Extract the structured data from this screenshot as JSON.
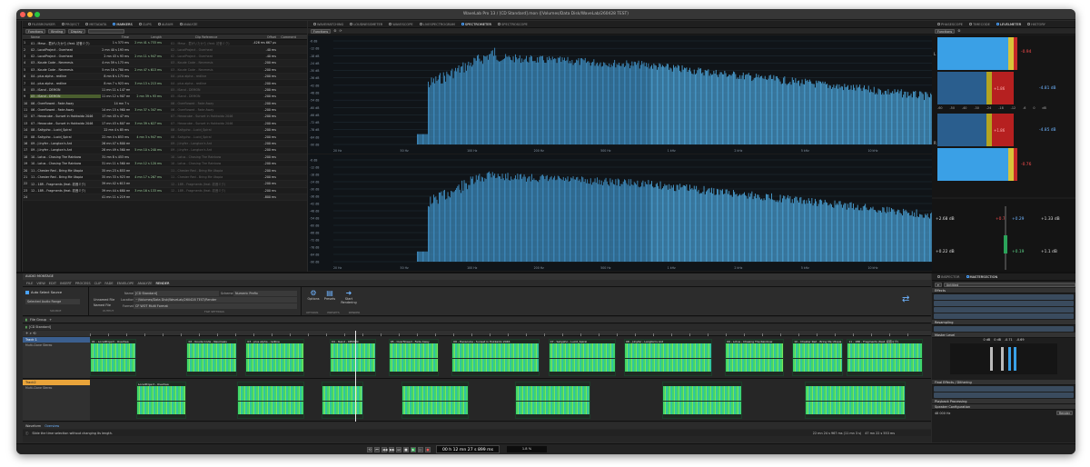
{
  "window": {
    "title": "WaveLab Pro 13 / [CD Standard].mon ([Volumes/Data Disk/WaveLab/260428 TEST)"
  },
  "left_panel": {
    "tabs": [
      "FILEBROWSER",
      "PROJECT",
      "METADATA",
      "MARKERS",
      "CLIPS",
      "ALBUM",
      "ANALYZE"
    ],
    "subtabs": [
      "Functions",
      "Binding",
      "Display"
    ],
    "columns": [
      "Name",
      "Time",
      "Length",
      "",
      "Clip Reference",
      "Offset",
      "Comment"
    ],
    "rows": [
      [
        "1",
        "01 - Mesa - 君がいたから (feat. 初音ミク)",
        "1 s 373 ms",
        "2 mn 41 s 733 ms",
        "-426 ms 667 µs"
      ],
      [
        "2",
        "02 - LocalProject - Overheat",
        "2 mn 40 s 193 ms",
        "",
        "-40 ms"
      ],
      [
        "3",
        "02 - LocalProject - Overheat",
        "2 mn 43 s 93 ms",
        "2 mn 11 s 947 ms",
        "-40 ms"
      ],
      [
        "4",
        "03 - Koude Code - Nevmesis",
        "4 mn 59 s 173 ms",
        "",
        "-200 ms"
      ],
      [
        "5",
        "03 - Koude Code - Nevmesis",
        "5 mn 16 s 780 ms",
        "2 mn 47 s 613 ms",
        "-200 ms"
      ],
      [
        "6",
        "04 - plus alpha - redline",
        "8 mn 6 s 173 ms",
        "",
        "-200 ms"
      ],
      [
        "7",
        "04 - plus alpha - redline",
        "8 mn 7 s 923 ms",
        "3 mn 13 s 213 ms",
        "-200 ms"
      ],
      [
        "8",
        "05 - iSand - DEMON",
        "11 mn 11 s 147 ms",
        "",
        "-200 ms"
      ],
      [
        "9",
        "05 - iSand - DEMON",
        "11 mn 12 s 907 ms",
        "2 mn 39 s 93 ms",
        "-200 ms"
      ],
      [
        "10",
        "06 - Overflowed - Fade Away",
        "14 mn 7 s",
        "",
        "-200 ms"
      ],
      [
        "11",
        "06 - Overflowed - Fade Away",
        "14 mn 15 s 960 ms",
        "3 mn 37 s 347 ms",
        "-200 ms"
      ],
      [
        "12",
        "07 - Hexacube - Sunset in Hokkaido 2046",
        "17 mn 43 s 47 ms",
        "",
        "-200 ms"
      ],
      [
        "13",
        "07 - Hexacube - Sunset in Hokkaido 2046",
        "17 mn 43 s 807 ms",
        "3 mn 39 s 627 ms",
        "-200 ms"
      ],
      [
        "14",
        "08 - Saliypho - Lucid_Spiral",
        "22 mn 4 s 85 ms",
        "",
        "-200 ms"
      ],
      [
        "15",
        "08 - Saliypho - Lucid_Spiral",
        "22 mn 4 s 853 ms",
        "4 mn 3 s 947 ms",
        "-200 ms"
      ],
      [
        "16",
        "09 - J.Inyfer - Langton's Ant",
        "26 mn 47 s 800 ms",
        "",
        "-200 ms"
      ],
      [
        "17",
        "09 - J.Inyfer - Langton's Ant",
        "28 mn 49 s 560 ms",
        "5 mn 10 s 240 ms",
        "-200 ms"
      ],
      [
        "18",
        "10 - Lotus - Chasing The Rainbow",
        "31 mn 8 s 453 ms",
        "",
        "-200 ms"
      ],
      [
        "19",
        "10 - Lotus - Chasing The Rainbow",
        "31 mn 11 s 560 ms",
        "3 mn 12 s 120 ms",
        "-200 ms"
      ],
      [
        "20",
        "11 - Chester Red - Bring Me Utopia",
        "35 mn 23 s 853 ms",
        "",
        "-200 ms"
      ],
      [
        "21",
        "11 - Chester Red - Bring Me Utopia",
        "35 mn 33 s 923 ms",
        "4 mn 17 s 267 ms",
        "-200 ms"
      ],
      [
        "22",
        "12 - 18R - Fragments (feat. 初音ミク)",
        "39 mn 42 s 613 ms",
        "",
        "-200 ms"
      ],
      [
        "23",
        "12 - 18R - Fragments (feat. 初音ミク)",
        "39 mn 44 s 680 ms",
        "3 mn 16 s 133 ms",
        "-200 ms"
      ],
      [
        "24",
        "",
        "41 mn 11 s 219 ms",
        "",
        "-800 ms"
      ]
    ]
  },
  "center_panel": {
    "tabs": [
      "WAVEMATCHING",
      "LOUDNESSMETER",
      "WAVESCOPE",
      "LIVESPECTROGRAM",
      "SPECTROMETER",
      "SPECTROSCOPE"
    ],
    "subtab": "Functions",
    "y_ticks": [
      "-6 dB",
      "-12 dB",
      "-18 dB",
      "-24 dB",
      "-30 dB",
      "-36 dB",
      "-42 dB",
      "-48 dB",
      "-54 dB",
      "-60 dB",
      "-66 dB",
      "-72 dB",
      "-78 dB",
      "-84 dB",
      "-90 dB"
    ],
    "x_ticks": [
      "20 Hz",
      "50 Hz",
      "100 Hz",
      "200 Hz",
      "500 Hz",
      "1 kHz",
      "2 kHz",
      "5 kHz",
      "10 kHz",
      "20 kHz"
    ]
  },
  "right_panel": {
    "tabs": [
      "PHASESCOPE",
      "TIMECODE",
      "LEVELMETER",
      "HISTORY"
    ],
    "subtab": "Functions",
    "peak_top": "-0.94",
    "rms_top": "-4.81 dB",
    "peak_bot": "-0.76",
    "rms_bot": "-4.85 dB",
    "mid_top": "+1.86",
    "mid_bot": "+1.86",
    "scale": [
      "-60",
      "-50",
      "-40",
      "-30",
      "-24",
      "-18",
      "-12",
      "-6",
      "0",
      "dB"
    ],
    "read_a": "+2.68 dB",
    "read_b": "+0.7",
    "read_c": "+0.29",
    "read_d": "+1.33 dB",
    "read_e": "+0.22 dB",
    "read_f": "+0.19",
    "read_g": "+1.1 dB",
    "ch_l": "L",
    "ch_r": "R"
  },
  "montage": {
    "header": "AUDIO MONTAGE",
    "tabs": [
      "FILE",
      "VIEW",
      "EDIT",
      "INSERT",
      "PROCESS",
      "CLIP",
      "FADE",
      "ENVELOPE",
      "ANALYZE",
      "RENDER"
    ],
    "active_tab": "RENDER",
    "auto_select": "Auto Select Source",
    "selected_range": "Selected Audio Range",
    "source_label": "SOURCE",
    "output": {
      "name_label": "Name",
      "name_value": "[CD Standard]",
      "location_label": "Location",
      "location_value": "~/Volumes/Data Disk/WaveLab/260428 TEST/Render",
      "unnamed": "Unnamed File",
      "named": "Named File",
      "format_label": "Format",
      "format_value": "CF WOT Multi Format",
      "scheme": "Scheme",
      "scheme_value": "Numeric Prefix",
      "section": "OUTPUT",
      "file_settings": "FILE SETTINGS"
    },
    "options": [
      "Options",
      "Presets",
      "Start Rendering"
    ],
    "options_labels": [
      "OPTIONS",
      "PRESETS",
      "RENDER"
    ],
    "file_group": "File Group",
    "montage_name": "[CD Standard]",
    "track1": "Track 1",
    "track1_sub": "Multi-Clone Stereo",
    "track2": "Track2",
    "track2_sub": "Multi-Clone Stereo",
    "bottom_labels": [
      "Waveform",
      "Overview"
    ],
    "hint": "Slide the time selection without changing its length.",
    "time_status": "22 mn 24 s 967 ms (11 mn 3 s)",
    "time_range": "47 mn 22 s 553 ms"
  },
  "clips": [
    {
      "t": "01 - LocalProject - Overhea",
      "track": 1,
      "x": 0.0,
      "w": 0.055
    },
    {
      "t": "02 - Koude Code - Nevmesis",
      "track": 1,
      "x": 0.115,
      "w": 0.06
    },
    {
      "t": "03 - plus alpha - redline",
      "track": 1,
      "x": 0.185,
      "w": 0.07
    },
    {
      "t": "04 - iSand - DEMON",
      "track": 1,
      "x": 0.285,
      "w": 0.055
    },
    {
      "t": "05 - Overflowed - Fade Away",
      "track": 1,
      "x": 0.355,
      "w": 0.06
    },
    {
      "t": "06 - Hexacube - Sunset in Hokkaido 2046",
      "track": 1,
      "x": 0.43,
      "w": 0.105
    },
    {
      "t": "07 - Saliypho - Lucid_Spiral",
      "track": 1,
      "x": 0.545,
      "w": 0.08
    },
    {
      "t": "08 - J.Inyfer - Langton's Ant",
      "track": 1,
      "x": 0.635,
      "w": 0.105
    },
    {
      "t": "09 - Lotus - Chasing The Rainbow",
      "track": 1,
      "x": 0.755,
      "w": 0.07
    },
    {
      "t": "10 - Chester Red - Bring Me Utopia",
      "track": 1,
      "x": 0.835,
      "w": 0.06
    },
    {
      "t": "11 - 18R - Fragments (feat. 初音ミク)",
      "track": 1,
      "x": 0.9,
      "w": 0.09
    }
  ],
  "clips2": [
    {
      "t": "LocalProject - Overhea",
      "x": 0.055,
      "w": 0.06
    },
    {
      "t": "",
      "x": 0.175,
      "w": 0.08
    },
    {
      "t": "",
      "x": 0.275,
      "w": 0.05
    },
    {
      "t": "",
      "x": 0.37,
      "w": 0.08
    },
    {
      "t": "",
      "x": 0.505,
      "w": 0.09
    },
    {
      "t": "",
      "x": 0.68,
      "w": 0.095
    },
    {
      "t": "",
      "x": 0.85,
      "w": 0.12
    }
  ],
  "inspector": {
    "tabs": [
      "INSPECTOR",
      "MASTERSECTION"
    ],
    "preset": "Untitled",
    "effects": "Effects",
    "resampling": "Resampling",
    "master_level": "Master Level",
    "ml_values": [
      "0 dB",
      "0 dB",
      "-0.71",
      "-0.69"
    ],
    "final": "Final Effects / Dithering",
    "playback": "Playback Processing",
    "speaker": "Speaker Configuration",
    "rate": "48 000 Hz",
    "render": "Render"
  },
  "transport": {
    "time": "00 h 12 mn 27 s 899 ms",
    "zoom": "1.8 %"
  }
}
